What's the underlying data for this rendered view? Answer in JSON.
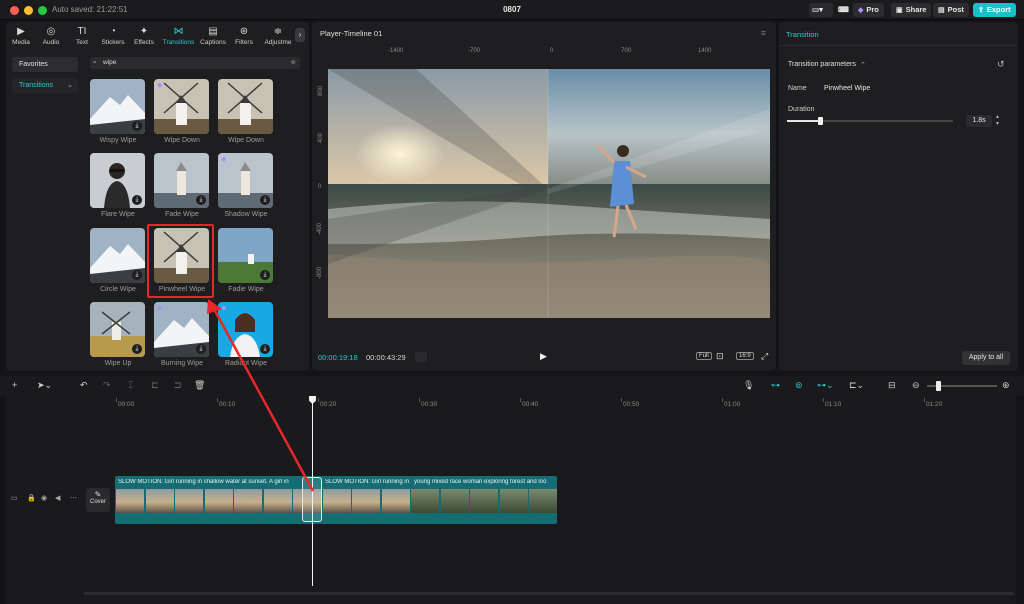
{
  "titlebar": {
    "autosave": "Auto saved: 21:22:51",
    "title": "0807",
    "pro": "Pro",
    "share": "Share",
    "post": "Post",
    "export": "Export"
  },
  "media_tabs": [
    {
      "label": "Media",
      "icon": "media-icon"
    },
    {
      "label": "Audio",
      "icon": "audio-icon"
    },
    {
      "label": "Text",
      "icon": "text-icon"
    },
    {
      "label": "Stickers",
      "icon": "stickers-icon"
    },
    {
      "label": "Effects",
      "icon": "effects-icon"
    },
    {
      "label": "Transitions",
      "icon": "transitions-icon"
    },
    {
      "label": "Captions",
      "icon": "captions-icon"
    },
    {
      "label": "Filters",
      "icon": "filters-icon"
    },
    {
      "label": "Adjustme",
      "icon": "adjustment-icon"
    }
  ],
  "sidebar": {
    "favorites": "Favorites",
    "transitions": "Transitions"
  },
  "search": {
    "value": "wipe"
  },
  "transitions": [
    {
      "label": "Wispy Wipe",
      "thumb": "mountain",
      "download": true,
      "pro": false
    },
    {
      "label": "Wipe Down",
      "thumb": "windmill",
      "download": false,
      "pro": true
    },
    {
      "label": "Wipe Down",
      "thumb": "windmill",
      "download": false,
      "pro": false
    },
    {
      "label": "Flare Wipe",
      "thumb": "person",
      "download": true,
      "pro": false
    },
    {
      "label": "Fade Wipe",
      "thumb": "tower",
      "download": true,
      "pro": false
    },
    {
      "label": "Shadow Wipe",
      "thumb": "tower",
      "download": true,
      "pro": true
    },
    {
      "label": "Circle Wipe",
      "thumb": "mountain",
      "download": true,
      "pro": false
    },
    {
      "label": "Pinwheel Wipe",
      "thumb": "windmill",
      "download": false,
      "pro": false
    },
    {
      "label": "Fadie Wipe",
      "thumb": "field",
      "download": true,
      "pro": false
    },
    {
      "label": "Wipe Up",
      "thumb": "wheat",
      "download": true,
      "pro": false
    },
    {
      "label": "Burning Wipe",
      "thumb": "mountain",
      "download": true,
      "pro": true
    },
    {
      "label": "Radiant Wipe",
      "thumb": "woman",
      "download": true,
      "pro": true
    }
  ],
  "player": {
    "title": "Player-Timeline 01",
    "ruler_h": [
      "-1400",
      "-700",
      "0",
      "700",
      "1400"
    ],
    "ruler_v": [
      "800",
      "400",
      "0",
      "-400",
      "-800"
    ],
    "current_time": "00:00:19:18",
    "total_time": "00:00:43:29",
    "full": "Full",
    "ratio": "16:9"
  },
  "transition_panel": {
    "tab": "Transition",
    "section": "Transition parameters",
    "name_label": "Name",
    "name_value": "Pinwheel Wipe",
    "duration_label": "Duration",
    "duration_value": "1.8s",
    "duration_fraction": 0.2,
    "apply_all": "Apply to all"
  },
  "timeline": {
    "ticks": [
      "00:00",
      "00:10",
      "00:20",
      "00:30",
      "00:40",
      "00:50",
      "01:00",
      "01:10",
      "01:20"
    ],
    "cover": "Cover",
    "clip1_text": "SLOW MOTION: Girl running in shallow water at sunset. A girl in",
    "clip2_text": "SLOW MOTION: Girl running in",
    "clip3_text": "young mixed race woman exploring forest and loo"
  },
  "colors": {
    "accent": "#18c2cb",
    "clip_teal": "#156c73",
    "selection_red": "#e8262b"
  }
}
